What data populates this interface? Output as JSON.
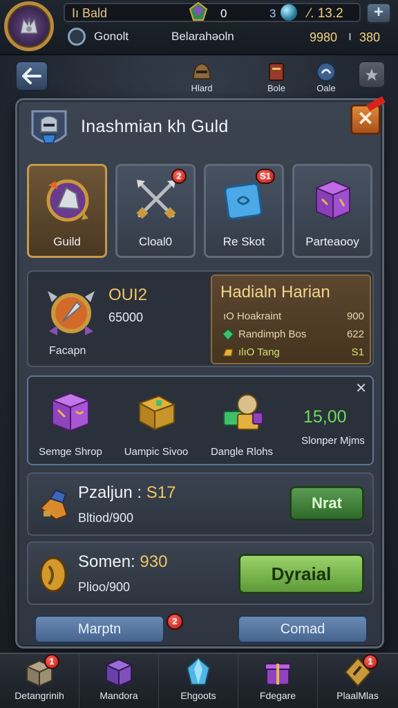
{
  "header": {
    "player_name": "Iı Bald",
    "gems": "0",
    "level_prefix": "3",
    "ratio": "⁄. 13.2",
    "gold_label": "Gonolt",
    "location": "Belarahəoln",
    "currency_1": "9980",
    "separator": "ı",
    "currency_2": "380",
    "plus_label": "+"
  },
  "nav": {
    "items": [
      {
        "label": "Hlard"
      },
      {
        "label": "Bole"
      },
      {
        "label": "Oale"
      }
    ],
    "badge_oale": ""
  },
  "panel": {
    "title": "Inashmian kh Guld",
    "close_label": "✕",
    "tabs": [
      {
        "label": "Guild",
        "badge": ""
      },
      {
        "label": "Cloal0",
        "badge": "2"
      },
      {
        "label": "Re Skot",
        "badge": "S1"
      },
      {
        "label": "Parteaooy",
        "badge": ""
      }
    ],
    "guild_info": {
      "name": "OUI2",
      "number": "65000",
      "label": "Facapn",
      "rewards": {
        "title": "Hadialn Harian",
        "rows": [
          {
            "text": "ıO Hoakraint",
            "value": "900",
            "color": "#e9d6b0"
          },
          {
            "text": "Randimph Bos",
            "value": "622",
            "color": "#e9d6b0"
          },
          {
            "text": "ılıO Tang",
            "value": "S1",
            "color": "#cfe86a"
          }
        ]
      }
    },
    "shop": {
      "close_label": "✕",
      "items": [
        {
          "label": "Semge Shrop"
        },
        {
          "label": "Uampic Sivoo"
        },
        {
          "label": "Dangle Rlohs"
        },
        {
          "label": "Slonper Mjms"
        }
      ],
      "value": "15,00"
    },
    "row1": {
      "title": "Pzaljun :",
      "title_value": "S17",
      "subtitle": "Bltiod/900",
      "button": "Nrat"
    },
    "row2": {
      "title": "Somen:",
      "title_value": "930",
      "subtitle": "Plioo/900",
      "button": "Dyraial"
    },
    "bottom_buttons": {
      "left": "Marptn",
      "right": "Comad",
      "badge": "2"
    }
  },
  "bottom_nav": [
    {
      "label": "Detangrinih",
      "badge": "1"
    },
    {
      "label": "Mandora",
      "badge": ""
    },
    {
      "label": "Ehgoots",
      "badge": ""
    },
    {
      "label": "Fdegare",
      "badge": ""
    },
    {
      "label": "PlaalMlas",
      "badge": "1"
    }
  ],
  "colors": {
    "accent_gold": "#f0c568",
    "value_green": "#6fdc5a",
    "badge_red": "#d8231a",
    "close_orange": "#c96d2a"
  }
}
